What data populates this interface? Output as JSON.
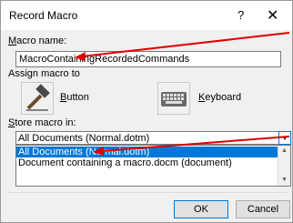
{
  "dialog": {
    "title": "Record Macro",
    "help_label": "?",
    "close_label": "✕"
  },
  "macro_name": {
    "label_u": "M",
    "label_rest": "acro name:",
    "value": "MacroContainingRecordedCommands"
  },
  "assign": {
    "label": "Assign macro to",
    "button_u": "B",
    "button_rest": "utton",
    "keyboard_u": "K",
    "keyboard_rest": "eyboard"
  },
  "store": {
    "label_u": "S",
    "label_rest": "tore macro in:",
    "selected": "All Documents (Normal.dotm)",
    "options": [
      "All Documents (Normal.dotm)",
      "Document containing a macro.docm (document)"
    ],
    "selected_index": 0
  },
  "buttons": {
    "ok": "OK",
    "cancel": "Cancel"
  },
  "colors": {
    "annotation_arrow": "#e00000",
    "selection": "#0078d7"
  }
}
